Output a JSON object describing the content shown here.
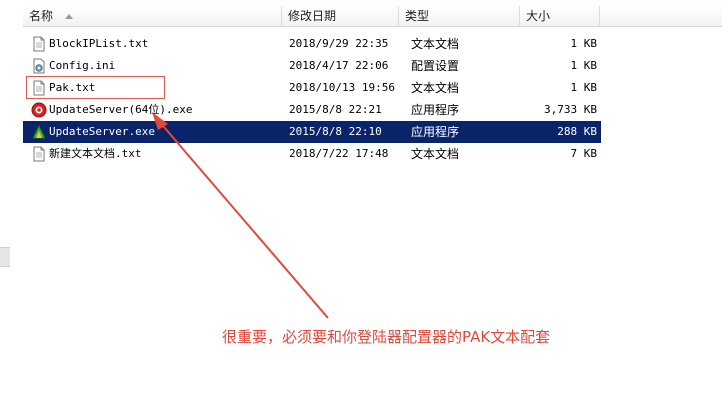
{
  "columns": {
    "name": "名称",
    "date": "修改日期",
    "type": "类型",
    "size": "大小"
  },
  "files": [
    {
      "name": "BlockIPList.txt",
      "date": "2018/9/29 22:35",
      "type": "文本文档",
      "size": "1 KB",
      "icon": "text-file-icon"
    },
    {
      "name": "Config.ini",
      "date": "2018/4/17 22:06",
      "type": "配置设置",
      "size": "1 KB",
      "icon": "settings-file-icon"
    },
    {
      "name": "Pak.txt",
      "date": "2018/10/13 19:56",
      "type": "文本文档",
      "size": "1 KB",
      "icon": "text-file-icon"
    },
    {
      "name": "UpdateServer(64位).exe",
      "date": "2015/8/8 22:21",
      "type": "应用程序",
      "size": "3,733 KB",
      "icon": "red-app-icon"
    },
    {
      "name": "UpdateServer.exe",
      "date": "2015/8/8 22:10",
      "type": "应用程序",
      "size": "288 KB",
      "icon": "green-app-icon",
      "selected": true
    },
    {
      "name": "新建文本文档.txt",
      "date": "2018/7/22 17:48",
      "type": "文本文档",
      "size": "7 KB",
      "icon": "text-file-icon"
    }
  ],
  "annotation": {
    "text": "很重要，必须要和你登陆器配置器的PAK文本配套"
  },
  "colors": {
    "selection": "#0a246a",
    "annotation": "#e0493c"
  }
}
